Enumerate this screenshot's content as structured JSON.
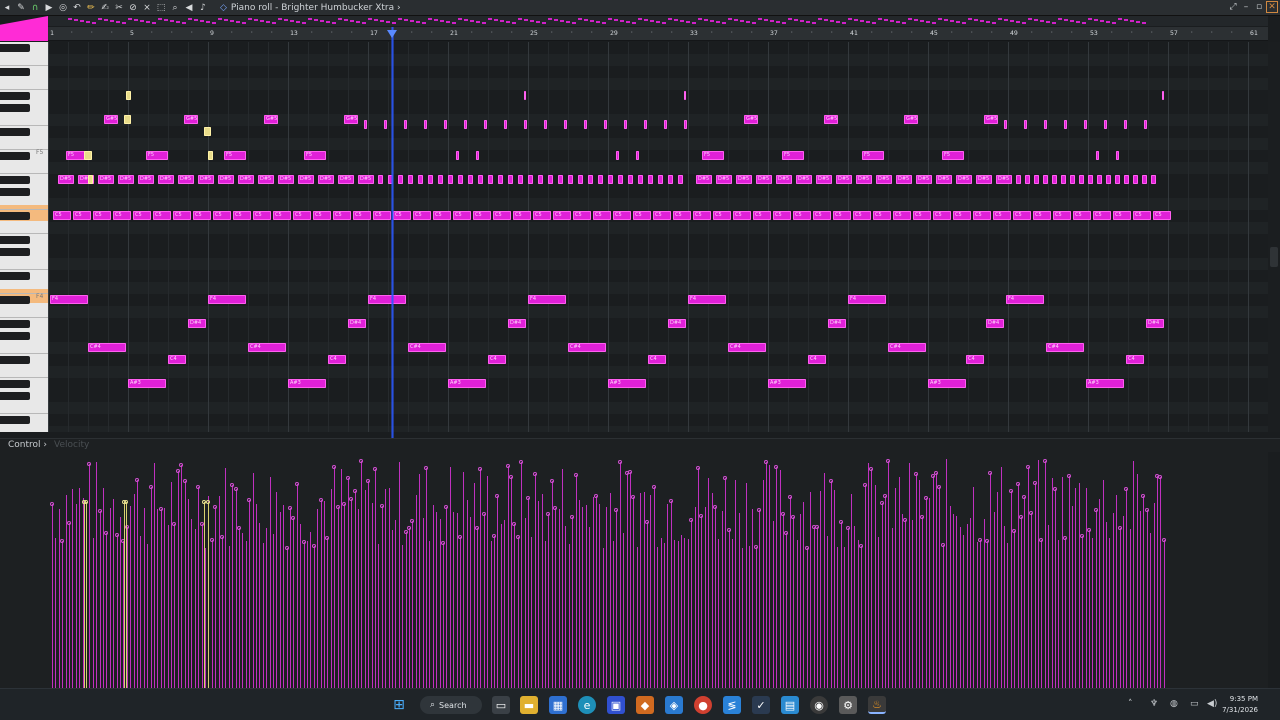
{
  "window": {
    "title": "Piano roll - Brighter Humbucker Xtra",
    "title_arrow": "›",
    "controls": {
      "minimize": "–",
      "maximize": "▫",
      "close": "✕",
      "pin": "⤢"
    }
  },
  "toolbar": {
    "tools": [
      {
        "name": "wrench-icon",
        "glyph": "✎"
      },
      {
        "name": "magnet-icon",
        "glyph": "⌒"
      },
      {
        "name": "snap-icon",
        "glyph": "∩"
      },
      {
        "name": "play-icon",
        "glyph": "▶"
      },
      {
        "name": "target-icon",
        "glyph": "◎"
      },
      {
        "name": "undo-icon",
        "glyph": "↶"
      },
      {
        "name": "pencil-icon",
        "glyph": "✏"
      },
      {
        "name": "paint-icon",
        "glyph": "✍"
      },
      {
        "name": "delete-icon",
        "glyph": "✂"
      },
      {
        "name": "mute-icon",
        "glyph": "⊘"
      },
      {
        "name": "slice-icon",
        "glyph": "⨯"
      },
      {
        "name": "select-icon",
        "glyph": "⬚"
      },
      {
        "name": "zoom-icon",
        "glyph": "⌕"
      },
      {
        "name": "playback-icon",
        "glyph": "◀"
      }
    ]
  },
  "ruler": {
    "bar_labels": [
      "1",
      "5",
      "9",
      "13",
      "17",
      "21",
      "25",
      "29",
      "33",
      "37",
      "41",
      "45",
      "49",
      "53",
      "57",
      "61"
    ]
  },
  "keys": {
    "labels": [
      "F5",
      "F4"
    ]
  },
  "control": {
    "label": "Control",
    "arrow": "›",
    "target": "Velocity"
  },
  "taskbar": {
    "search_label": "Search",
    "time": "9:35 PM",
    "date": "7/31/2026"
  },
  "note_label_sets": {
    "row_a": "G#5",
    "row_b": "F5",
    "row_c": "D#5",
    "row_d": "C5",
    "row_e": "F4",
    "row_f": "D#4",
    "row_g": "C#4",
    "row_h": "C4",
    "row_i": "A#3"
  }
}
